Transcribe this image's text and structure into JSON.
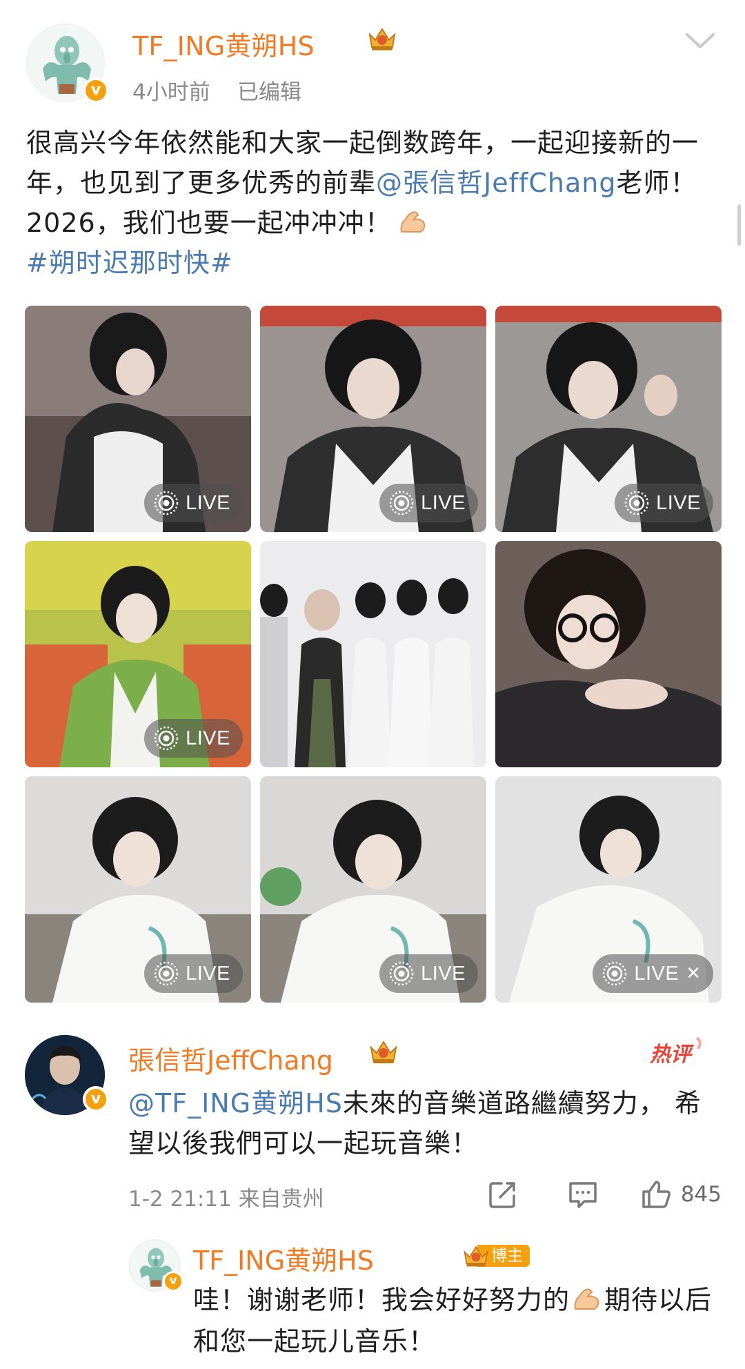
{
  "post": {
    "author": "TF_ING黄朔HS",
    "time": "4小时前",
    "edited": "已编辑",
    "text_part1": "很高兴今年依然能和大家一起倒数跨年，一起迎接新的一年，也见到了更多优秀的前辈",
    "mention": "@張信哲JeffChang",
    "text_part2": "老师！2026，我们也要一起冲冲冲！",
    "emoji": "muscle-emoji",
    "hashtag": "#朔时迟那时快#"
  },
  "images": [
    {
      "live": true,
      "live_label": "LIVE",
      "bg": "#7a6e6c"
    },
    {
      "live": true,
      "live_label": "LIVE",
      "bg": "#8e8a88"
    },
    {
      "live": true,
      "live_label": "LIVE",
      "bg": "#8c8886"
    },
    {
      "live": true,
      "live_label": "LIVE",
      "bg": "#c9c24a"
    },
    {
      "live": false,
      "bg": "#e7e7e9"
    },
    {
      "live": false,
      "bg": "#7a6a64"
    },
    {
      "live": true,
      "live_label": "LIVE",
      "bg": "#d8d7d6"
    },
    {
      "live": true,
      "live_label": "LIVE",
      "bg": "#d6d4d2"
    },
    {
      "live": true,
      "live_label": "LIVE",
      "bg": "#dcdcdc",
      "closable": true
    }
  ],
  "comment": {
    "author": "張信哲JeffChang",
    "hot_badge": "热评",
    "mention": "@TF_ING黄朔HS",
    "text": "未來的音樂道路繼續努力， 希望以後我們可以一起玩音樂！",
    "meta": "1-2 21:11 来自贵州",
    "likes": "845"
  },
  "reply": {
    "author": "TF_ING黄朔HS",
    "blogger_label": "博主",
    "text_part1": "哇！谢谢老师！我会好好努力的",
    "text_part2": "期待以后和您一起玩儿音乐！"
  },
  "colors": {
    "username": "#f17a22",
    "link": "#4a7bb0",
    "verify": "#f5a10f",
    "meta": "#8a8a8a"
  }
}
